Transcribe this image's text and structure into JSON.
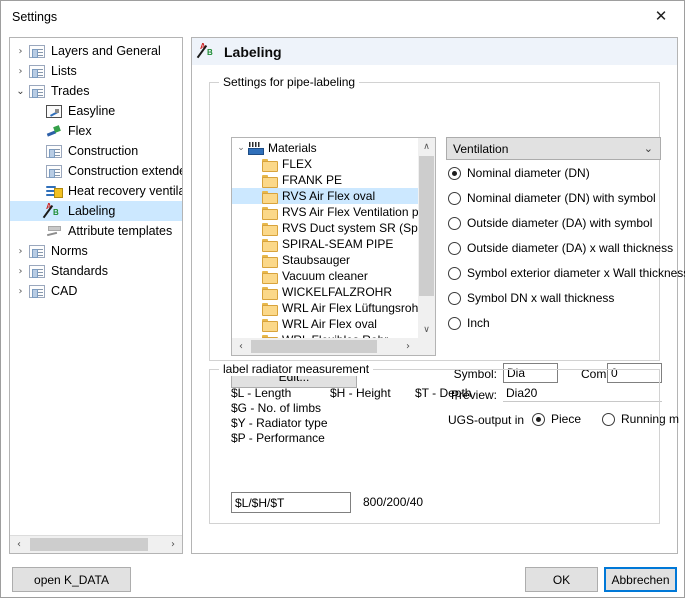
{
  "window": {
    "title": "Settings",
    "close_icon": "close-icon"
  },
  "sidebar": {
    "items": [
      {
        "label": "Layers and General",
        "icon": "page-icon",
        "twisty": "collapsed",
        "level": 0,
        "selected": false
      },
      {
        "label": "Lists",
        "icon": "page-icon",
        "twisty": "collapsed",
        "level": 0,
        "selected": false
      },
      {
        "label": "Trades",
        "icon": "page-icon",
        "twisty": "expanded",
        "level": 0,
        "selected": false
      },
      {
        "label": "Easyline",
        "icon": "easyline-icon",
        "twisty": "none",
        "level": 1,
        "selected": false
      },
      {
        "label": "Flex",
        "icon": "flex-icon",
        "twisty": "none",
        "level": 1,
        "selected": false
      },
      {
        "label": "Construction",
        "icon": "page-icon",
        "twisty": "none",
        "level": 1,
        "selected": false
      },
      {
        "label": "Construction extended",
        "icon": "page-icon",
        "twisty": "none",
        "level": 1,
        "selected": false
      },
      {
        "label": "Heat recovery ventilation",
        "icon": "heat-recovery-icon",
        "twisty": "none",
        "level": 1,
        "selected": false
      },
      {
        "label": "Labeling",
        "icon": "labeling-icon",
        "twisty": "none",
        "level": 1,
        "selected": true
      },
      {
        "label": "Attribute templates",
        "icon": "attribute-icon",
        "twisty": "none",
        "level": 1,
        "selected": false
      },
      {
        "label": "Norms",
        "icon": "page-icon",
        "twisty": "collapsed",
        "level": 0,
        "selected": false
      },
      {
        "label": "Standards",
        "icon": "page-icon",
        "twisty": "collapsed",
        "level": 0,
        "selected": false
      },
      {
        "label": "CAD",
        "icon": "page-icon",
        "twisty": "collapsed",
        "level": 0,
        "selected": false
      }
    ],
    "twisty_collapsed_glyph": "›",
    "twisty_expanded_glyph": "⌄",
    "hscroll": {
      "left_glyph": "‹",
      "right_glyph": "›"
    }
  },
  "content": {
    "header": {
      "title": "Labeling",
      "icon": "labeling-icon"
    },
    "pipe_group": {
      "title": "Settings for pipe-labeling",
      "materials_tree": {
        "root": {
          "label": "Materials",
          "icon": "materials-icon",
          "twisty": "expanded"
        },
        "items": [
          "FLEX",
          "FRANK PE",
          "RVS Air Flex oval",
          "RVS Air Flex Ventilation pipe",
          "RVS Duct system SR (Spiral)",
          "SPIRAL-SEAM PIPE",
          "Staubsauger",
          "Vacuum cleaner",
          "WICKELFALZROHR",
          "WRL Air Flex Lüftungsrohr",
          "WRL Air Flex oval",
          "WRL Flexibles Rohr"
        ],
        "selected_index": 2,
        "scroll_up_glyph": "∧",
        "scroll_down_glyph": "∨",
        "scroll_left_glyph": "‹",
        "scroll_right_glyph": "›"
      },
      "edit_button": "Edit...",
      "trade_combo": {
        "value": "Ventilation",
        "arrow_glyph": "⌄"
      },
      "label_format_options": [
        {
          "label": "Nominal diameter (DN)",
          "selected": true
        },
        {
          "label": "Nominal diameter (DN) with symbol",
          "selected": false
        },
        {
          "label": "Outside diameter (DA) with symbol",
          "selected": false
        },
        {
          "label": "Outside diameter (DA) x wall thickness",
          "selected": false
        },
        {
          "label": "Symbol exterior diameter x Wall thickness",
          "selected": false
        },
        {
          "label": "Symbol DN x wall thickness",
          "selected": false
        },
        {
          "label": "Inch",
          "selected": false
        }
      ],
      "symbol_label": "Symbol:",
      "symbol_value": "Dia",
      "comma_label": "Comma",
      "comma_value": "0",
      "preview_label": "Preview:",
      "preview_value": "Dia20",
      "ugs_label": "UGS-output in",
      "ugs_options": [
        {
          "label": "Piece",
          "selected": true
        },
        {
          "label": "Running m",
          "selected": false
        }
      ]
    },
    "radiator_group": {
      "title": "label radiator measurement",
      "legend": [
        {
          "col1": "$L - Length",
          "col2": "$H - Height",
          "col3": "$T - Depth"
        },
        {
          "col1": "$G - No. of limbs",
          "col2": "",
          "col3": ""
        },
        {
          "col1": "$Y - Radiator type",
          "col2": "",
          "col3": ""
        },
        {
          "col1": "$P - Performance",
          "col2": "",
          "col3": ""
        }
      ],
      "format_value": "$L/$H/$T",
      "result_value": "800/200/40"
    }
  },
  "footer": {
    "open_kdata_label": "open K_DATA",
    "ok_label": "OK",
    "cancel_label": "Abbrechen"
  }
}
